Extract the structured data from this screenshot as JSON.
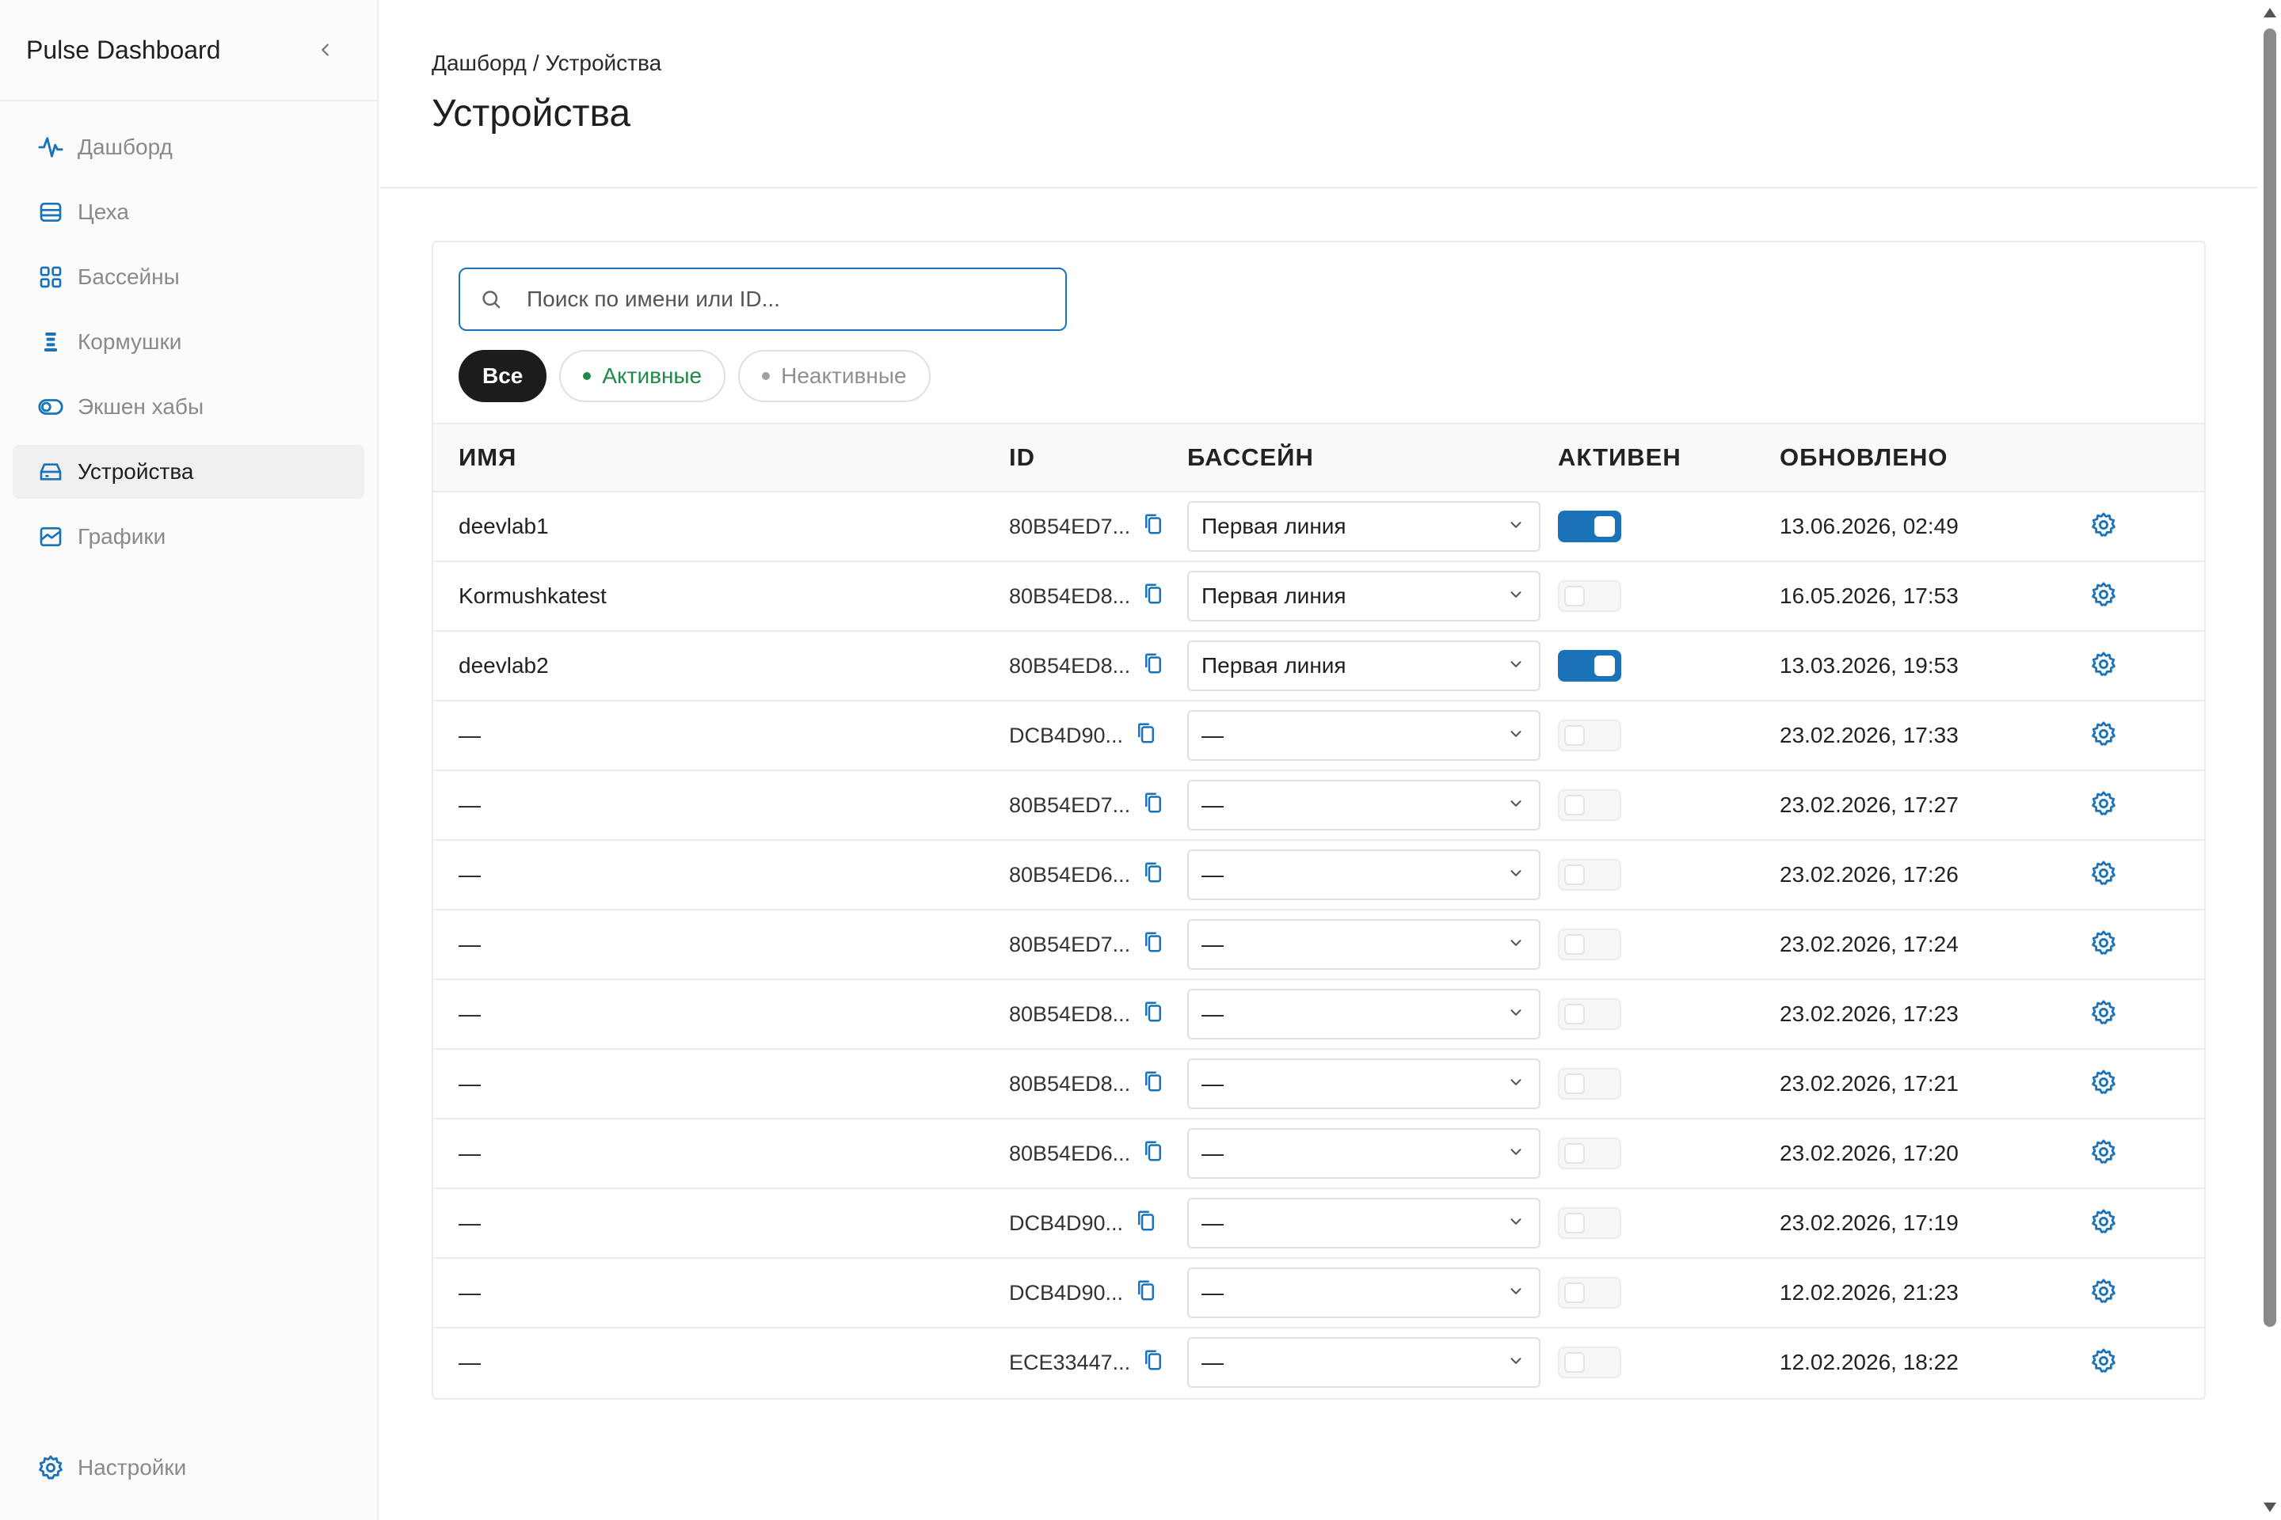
{
  "app": {
    "title": "Pulse Dashboard"
  },
  "sidebar": {
    "items": [
      {
        "label": "Дашборд",
        "icon": "activity-icon"
      },
      {
        "label": "Цеха",
        "icon": "layers-icon"
      },
      {
        "label": "Бассейны",
        "icon": "grid-icon"
      },
      {
        "label": "Кормушки",
        "icon": "feeder-icon"
      },
      {
        "label": "Экшен хабы",
        "icon": "toggle-icon"
      },
      {
        "label": "Устройства",
        "icon": "device-icon",
        "active": true
      },
      {
        "label": "Графики",
        "icon": "chart-icon"
      }
    ],
    "settings_label": "Настройки"
  },
  "breadcrumb": {
    "home": "Дашборд",
    "separator": "/",
    "current": "Устройства"
  },
  "page": {
    "title": "Устройства"
  },
  "search": {
    "placeholder": "Поиск по имени или ID...",
    "value": ""
  },
  "filters": {
    "all": "Все",
    "active": "Активные",
    "inactive": "Неактивные",
    "selected": "all"
  },
  "table": {
    "headers": {
      "name": "ИМЯ",
      "id": "ID",
      "pool": "БАССЕЙН",
      "active": "АКТИВЕН",
      "updated": "ОБНОВЛЕНО"
    },
    "rows": [
      {
        "name": "deevlab1",
        "id": "80B54ED7...",
        "pool": "Первая линия",
        "active": true,
        "updated": "13.06.2026, 02:49"
      },
      {
        "name": "Kormushkatest",
        "id": "80B54ED8...",
        "pool": "Первая линия",
        "active": false,
        "updated": "16.05.2026, 17:53"
      },
      {
        "name": "deevlab2",
        "id": "80B54ED8...",
        "pool": "Первая линия",
        "active": true,
        "updated": "13.03.2026, 19:53"
      },
      {
        "name": "—",
        "id": "DCB4D90...",
        "pool": "—",
        "active": false,
        "updated": "23.02.2026, 17:33"
      },
      {
        "name": "—",
        "id": "80B54ED7...",
        "pool": "—",
        "active": false,
        "updated": "23.02.2026, 17:27"
      },
      {
        "name": "—",
        "id": "80B54ED6...",
        "pool": "—",
        "active": false,
        "updated": "23.02.2026, 17:26"
      },
      {
        "name": "—",
        "id": "80B54ED7...",
        "pool": "—",
        "active": false,
        "updated": "23.02.2026, 17:24"
      },
      {
        "name": "—",
        "id": "80B54ED8...",
        "pool": "—",
        "active": false,
        "updated": "23.02.2026, 17:23"
      },
      {
        "name": "—",
        "id": "80B54ED8...",
        "pool": "—",
        "active": false,
        "updated": "23.02.2026, 17:21"
      },
      {
        "name": "—",
        "id": "80B54ED6...",
        "pool": "—",
        "active": false,
        "updated": "23.02.2026, 17:20"
      },
      {
        "name": "—",
        "id": "DCB4D90...",
        "pool": "—",
        "active": false,
        "updated": "23.02.2026, 17:19"
      },
      {
        "name": "—",
        "id": "DCB4D90...",
        "pool": "—",
        "active": false,
        "updated": "12.02.2026, 21:23"
      },
      {
        "name": "—",
        "id": "ECE33447...",
        "pool": "—",
        "active": false,
        "updated": "12.02.2026, 18:22"
      }
    ]
  },
  "colors": {
    "accent": "#1a73b8",
    "active_green": "#1f8a47",
    "muted": "#8a8a8a"
  }
}
